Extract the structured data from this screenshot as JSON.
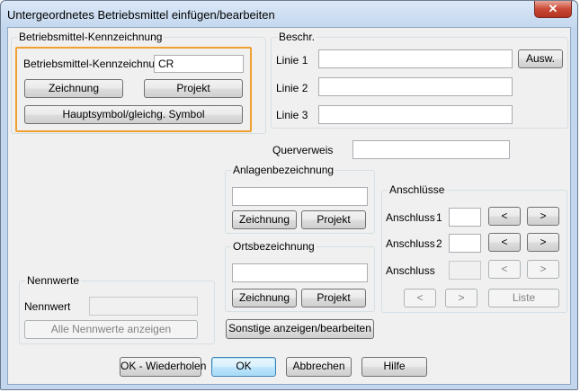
{
  "window": {
    "title": "Untergeordnetes Betriebsmittel einfügen/bearbeiten",
    "close_glyph": "✕"
  },
  "bmk_group": {
    "title": "Betriebsmittel-Kennzeichnung",
    "label": "Betriebsmittel-Kennzeichnung",
    "value": "CR",
    "zeichnung_button": "Zeichnung",
    "projekt_button": "Projekt",
    "hauptsymbol_button": "Hauptsymbol/gleichg. Symbol"
  },
  "beschr_group": {
    "title": "Beschr.",
    "linie1_label": "Linie 1",
    "linie2_label": "Linie 2",
    "linie3_label": "Linie 3",
    "linie1_value": "",
    "linie2_value": "",
    "linie3_value": "",
    "ausw_button": "Ausw."
  },
  "querverweis": {
    "label": "Querverweis",
    "value": ""
  },
  "anlagen_group": {
    "title": "Anlagenbezeichnung",
    "value": "",
    "zeichnung_button": "Zeichnung",
    "projekt_button": "Projekt"
  },
  "orts_group": {
    "title": "Ortsbezeichnung",
    "value": "",
    "zeichnung_button": "Zeichnung",
    "projekt_button": "Projekt"
  },
  "anschluesse_group": {
    "title": "Anschlüsse",
    "row1_label": "Anschluss",
    "row1_number": "1",
    "row2_label": "Anschluss",
    "row2_number": "2",
    "row3_label": "Anschluss",
    "prev_glyph": "<",
    "next_glyph": ">",
    "liste_button": "Liste"
  },
  "nennwerte_group": {
    "title": "Nennwerte",
    "nennwert_label": "Nennwert",
    "alle_button": "Alle Nennwerte anzeigen"
  },
  "sonstige_button": "Sonstige anzeigen/bearbeiten",
  "footer": {
    "ok_wiederholen": "OK - Wiederholen",
    "ok": "OK",
    "abbrechen": "Abbrechen",
    "hilfe": "Hilfe"
  },
  "colors": {
    "highlight": "#f0a030",
    "close_button": "#c94a36",
    "titlebar": "#c3d7ee"
  }
}
